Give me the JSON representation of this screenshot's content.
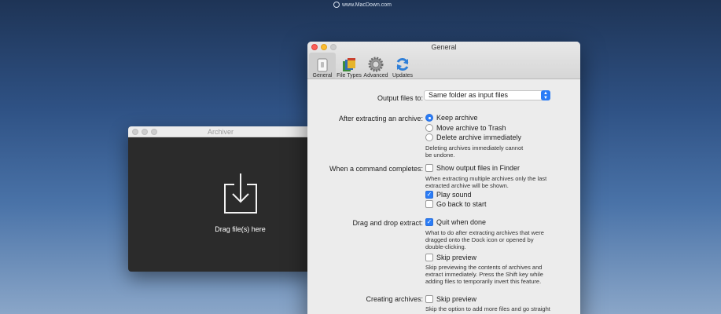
{
  "watermark": {
    "text": "www.MacDown.com"
  },
  "archiver": {
    "title": "Archiver",
    "drop_label": "Drag file(s) here"
  },
  "prefs": {
    "title": "General",
    "toolbar": [
      {
        "label": "General",
        "icon": "general-switch-icon"
      },
      {
        "label": "File Types",
        "icon": "file-types-icon"
      },
      {
        "label": "Advanced",
        "icon": "advanced-gear-icon"
      },
      {
        "label": "Updates",
        "icon": "updates-sync-icon"
      }
    ],
    "output": {
      "label": "Output files to:",
      "value": "Same folder as input files"
    },
    "after_extract": {
      "label": "After extracting an archive:",
      "options": [
        "Keep archive",
        "Move archive to Trash",
        "Delete archive immediately"
      ],
      "note": "Deleting archives immediately cannot be undone."
    },
    "command_completes": {
      "label": "When a command completes:",
      "show_output": "Show output files in Finder",
      "show_output_note": "When extracting multiple archives only the last extracted archive will be shown.",
      "play_sound": "Play sound",
      "go_back": "Go back to start"
    },
    "drag_drop": {
      "label": "Drag and drop extract:",
      "quit_when_done": "Quit when done",
      "quit_note": "What to do after extracting archives that were dragged onto the Dock icon or opened by double-clicking.",
      "skip_preview": "Skip preview",
      "skip_note": "Skip previewing the contents of archives and extract immediately. Press the Shift key while adding files to temporarily invert this feature."
    },
    "creating": {
      "label": "Creating archives:",
      "skip_preview": "Skip preview",
      "skip_note": "Skip the option to add more files and go straight"
    }
  },
  "colors": {
    "accent": "#2a7cf6",
    "desktop_top": "#1e3456",
    "desktop_bottom": "#8aa6c8"
  }
}
